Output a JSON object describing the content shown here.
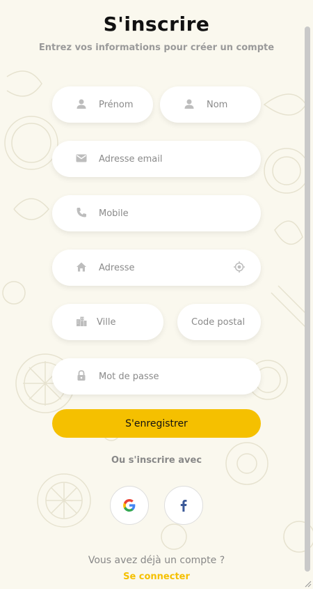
{
  "header": {
    "title": "S'inscrire",
    "subtitle": "Entrez vos informations pour créer un compte"
  },
  "form": {
    "first_name": {
      "placeholder": "Prénom",
      "icon": "person-icon"
    },
    "last_name": {
      "placeholder": "Nom",
      "icon": "person-icon"
    },
    "email": {
      "placeholder": "Adresse email",
      "icon": "mail-icon"
    },
    "mobile": {
      "placeholder": "Mobile",
      "icon": "phone-icon"
    },
    "address": {
      "placeholder": "Adresse",
      "icon": "home-icon",
      "action_icon": "locate-icon"
    },
    "city": {
      "placeholder": "Ville",
      "icon": "city-icon"
    },
    "postal_code": {
      "placeholder": "Code postal"
    },
    "password": {
      "placeholder": "Mot de passe",
      "icon": "lock-icon"
    },
    "submit_label": "S'enregistrer"
  },
  "social": {
    "heading": "Ou s'inscrire avec",
    "providers": [
      {
        "name": "google",
        "icon": "google-icon"
      },
      {
        "name": "facebook",
        "icon": "facebook-icon"
      }
    ]
  },
  "footer": {
    "question": "Vous avez déjà un compte ?",
    "login_label": "Se connecter"
  },
  "colors": {
    "background": "#faf8ee",
    "accent": "#f5c000",
    "muted_text": "#888888"
  }
}
